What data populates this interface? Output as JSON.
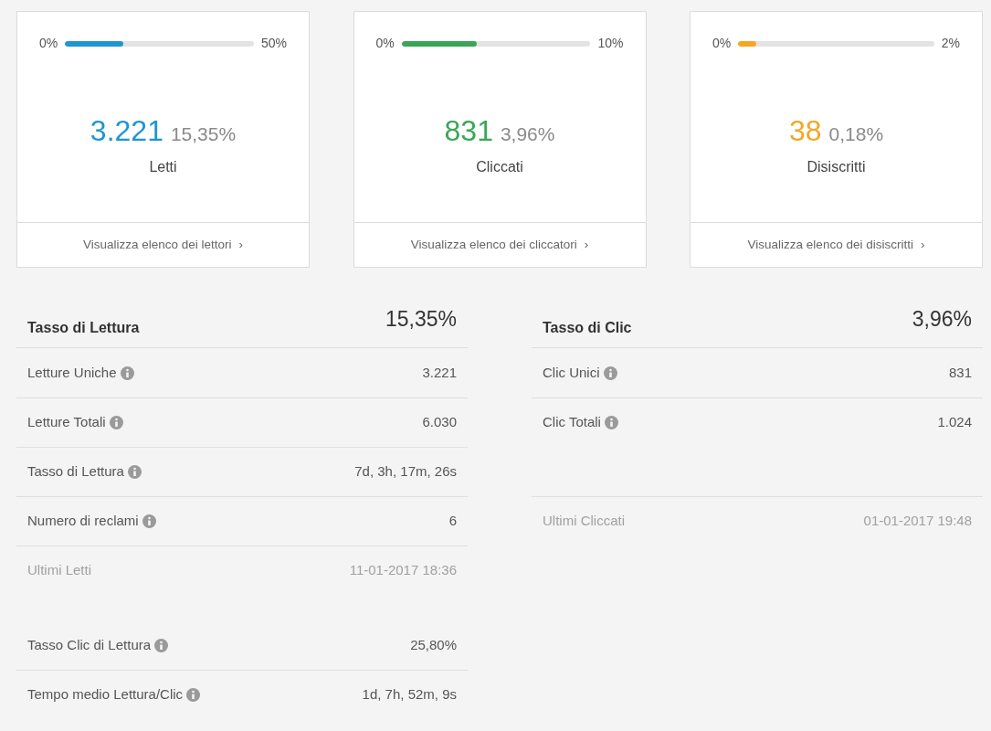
{
  "cards": [
    {
      "min": "0%",
      "max": "50%",
      "level": 0.31,
      "color": "#1e96d2",
      "count": "3.221",
      "percent": "15,35%",
      "label": "Letti",
      "link": "Visualizza elenco dei lettori",
      "link_icon": "›"
    },
    {
      "min": "0%",
      "max": "10%",
      "level": 0.4,
      "color": "#3aa655",
      "count": "831",
      "percent": "3,96%",
      "label": "Cliccati",
      "link": "Visualizza elenco dei cliccatori",
      "link_icon": "›"
    },
    {
      "min": "0%",
      "max": "2%",
      "level": 0.09,
      "color": "#f5a623",
      "count": "38",
      "percent": "0,18%",
      "label": "Disiscritti",
      "link": "Visualizza elenco dei disiscritti",
      "link_icon": "›"
    }
  ],
  "panels": [
    {
      "title": "Tasso di Lettura",
      "value": "15,35%",
      "rows": [
        {
          "kind": "stat",
          "label": "Letture Uniche",
          "info": true,
          "value": "3.221",
          "divider_above": false
        },
        {
          "kind": "stat",
          "label": "Letture Totali",
          "info": true,
          "value": "6.030",
          "divider_above": true
        },
        {
          "kind": "stat",
          "label": "Tasso di Lettura",
          "info": true,
          "value": "7d, 3h, 17m, 26s",
          "divider_above": true
        },
        {
          "kind": "stat",
          "label": "Numero di reclami",
          "info": true,
          "value": "6",
          "divider_above": true
        },
        {
          "kind": "recent",
          "label": "Ultimi Letti",
          "info": false,
          "value": "11-01-2017 18:36",
          "divider_above": true
        },
        {
          "kind": "gap",
          "divider_above": false
        },
        {
          "kind": "stat",
          "label": "Tasso Clic di Lettura",
          "info": true,
          "value": "25,80%",
          "divider_above": false
        },
        {
          "kind": "stat",
          "label": "Tempo medio Lettura/Clic",
          "info": true,
          "value": "1d, 7h, 52m, 9s",
          "divider_above": true
        }
      ]
    },
    {
      "title": "Tasso di Clic",
      "value": "3,96%",
      "rows": [
        {
          "kind": "stat",
          "label": "Clic Unici",
          "info": true,
          "value": "831",
          "divider_above": false
        },
        {
          "kind": "stat",
          "label": "Clic Totali",
          "info": true,
          "value": "1.024",
          "divider_above": true
        },
        {
          "kind": "blank",
          "divider_above": false
        },
        {
          "kind": "recent",
          "label": "Ultimi Cliccati",
          "info": false,
          "value": "01-01-2017 19:48",
          "divider_above": true
        }
      ]
    }
  ]
}
